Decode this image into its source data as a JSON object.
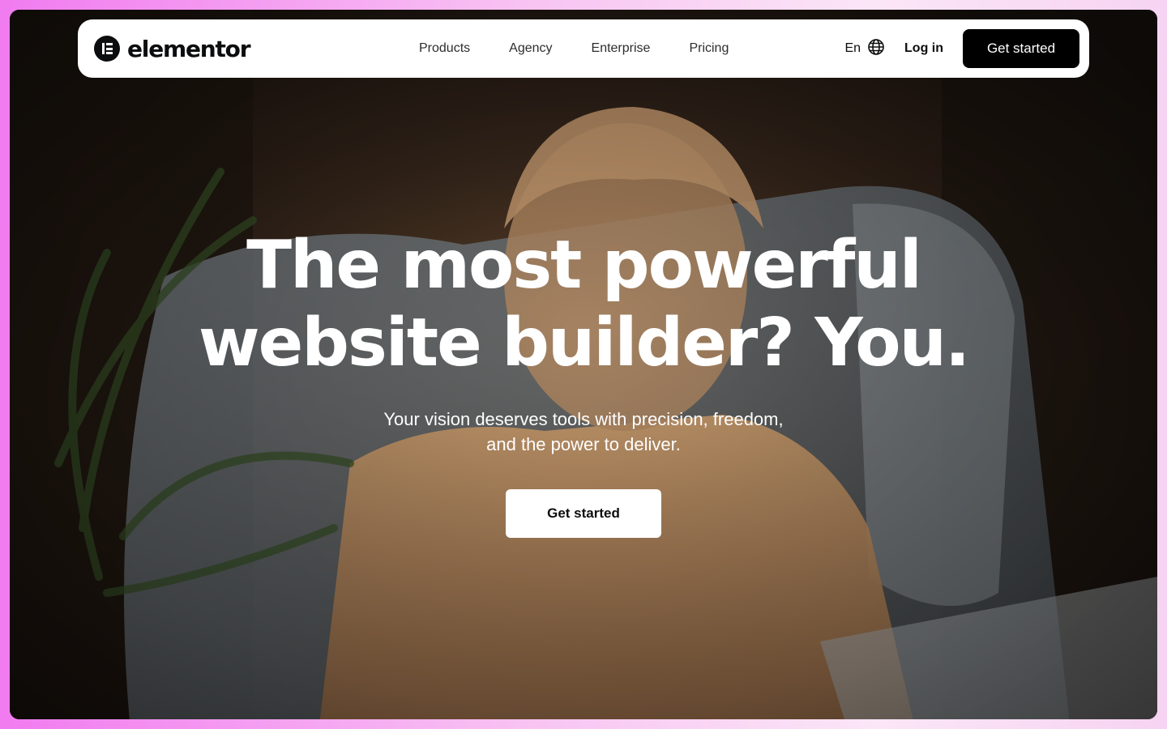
{
  "brand": {
    "name": "elementor",
    "logo_icon": "elementor-logo-icon"
  },
  "nav": {
    "links": [
      {
        "label": "Products"
      },
      {
        "label": "Agency"
      },
      {
        "label": "Enterprise"
      },
      {
        "label": "Pricing"
      }
    ],
    "language": "En",
    "language_icon": "globe-icon",
    "login_label": "Log in",
    "cta_label": "Get started"
  },
  "hero": {
    "headline_line1": "The most powerful",
    "headline_line2": "website builder? You.",
    "subhead_line1": "Your vision deserves tools with precision, freedom,",
    "subhead_line2": "and the power to deliver.",
    "cta_label": "Get started"
  },
  "colors": {
    "nav_cta_bg": "#000000",
    "hero_cta_bg": "#ffffff",
    "page_gradient": [
      "#f17bf0",
      "#fbe6f7"
    ]
  }
}
